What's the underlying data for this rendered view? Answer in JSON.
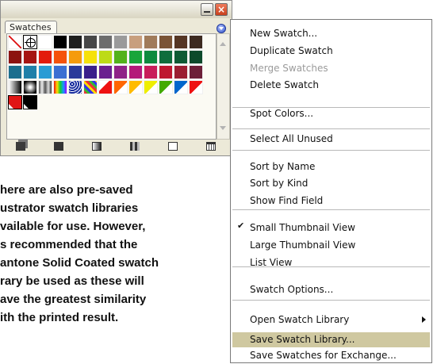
{
  "panel": {
    "tab_label": "Swatches",
    "accent_close": "#d64a2a",
    "accent_menu_button": "#2d4fc8"
  },
  "swatch_rows": [
    [
      "none",
      "registration",
      "#ffffff",
      "#000000",
      "#1e1e1e",
      "#474747",
      "#6d6d6d",
      "#9a9a9a",
      "#c89f7e",
      "#a07b5a",
      "#7a5436",
      "#553624",
      "#3d2a20"
    ],
    [
      "#8c1310",
      "#a61512",
      "#e31b0c",
      "#f5520c",
      "#f59b0c",
      "#f6e10c",
      "#bddb16",
      "#52b21b",
      "#19a53a",
      "#0e8a3e",
      "#0f6d3c",
      "#0e5a34",
      "#0d4a2b"
    ],
    [
      "#1b6f8e",
      "#1f7fa8",
      "#2a9cd4",
      "#3b6fd2",
      "#2b3a9a",
      "#3a1f8a",
      "#6b1f8f",
      "#8f2287",
      "#b4197a",
      "#c81d5a",
      "#be1730",
      "#9b1e32",
      "#6d1f38"
    ],
    [
      "gradient-bw",
      "gradient-radial",
      "gradient-metal",
      "gradient-rainbow",
      "pattern-blue",
      "pattern-multi",
      "pattern-flag",
      "pattern-arrow-1",
      "pattern-arrow-2",
      "pattern-arrow-3",
      "pattern-arrow-4",
      "pattern-arrow-5",
      "pattern-arrow-6"
    ],
    [
      "#e01515",
      "#000000"
    ]
  ],
  "bottom_icons": [
    "library-icon",
    "show-kinds-icon",
    "gradient-icon",
    "swatch-options-icon",
    "new-swatch-icon",
    "trash-icon"
  ],
  "menu": {
    "highlight_color": "#cfc8a0",
    "items": [
      {
        "label": "New Swatch...",
        "disabled": false
      },
      {
        "label": "Duplicate Swatch",
        "disabled": false
      },
      {
        "label": "Merge Swatches",
        "disabled": true
      },
      {
        "label": "Delete Swatch",
        "disabled": false
      },
      {
        "label": "Spot Colors...",
        "disabled": false
      },
      {
        "label": "Select All Unused",
        "disabled": false
      },
      {
        "label": "Sort by Name",
        "disabled": false
      },
      {
        "label": "Sort by Kind",
        "disabled": false
      },
      {
        "label": "Show Find Field",
        "disabled": false
      },
      {
        "label": "Small Thumbnail View",
        "disabled": false,
        "checked": true
      },
      {
        "label": "Large Thumbnail View",
        "disabled": false
      },
      {
        "label": "List View",
        "disabled": false
      },
      {
        "label": "Swatch Options...",
        "disabled": false
      },
      {
        "label": "Open Swatch Library",
        "disabled": false,
        "submenu": true
      },
      {
        "label": "Save Swatch Library...",
        "disabled": false,
        "highlighted": true
      },
      {
        "label": "Save Swatches for Exchange...",
        "disabled": false
      }
    ],
    "check_mark": "✔"
  },
  "caption": {
    "lines": [
      "here are also pre-saved",
      "ustrator swatch libraries",
      "vailable for use. However,",
      "s recommended that the",
      "antone Solid Coated swatch",
      "rary be used as these will",
      "ave the greatest similarity",
      "ith the printed result."
    ]
  }
}
